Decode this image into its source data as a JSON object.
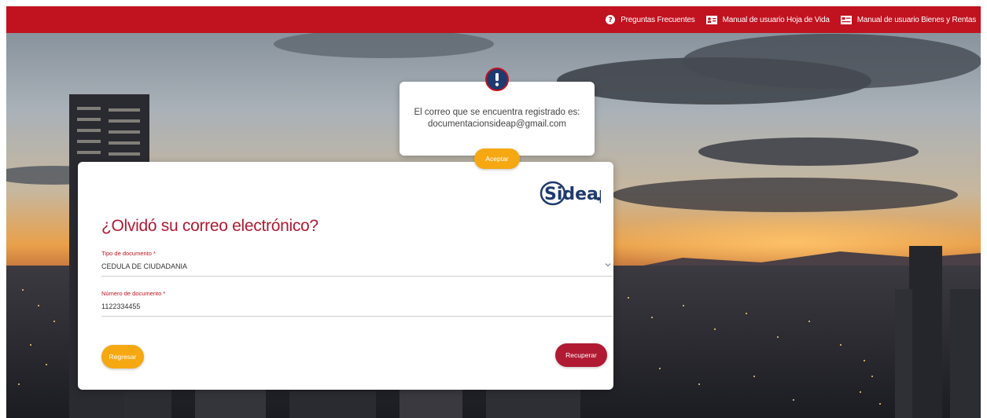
{
  "topbar": {
    "links": [
      {
        "label": "Preguntas Frecuentes",
        "icon": "question-circle-icon"
      },
      {
        "label": "Manual de usuario Hoja de Vida",
        "icon": "id-card-icon"
      },
      {
        "label": "Manual de usuario Bienes y Rentas",
        "icon": "document-card-icon"
      }
    ]
  },
  "alert": {
    "icon": "exclamation-icon",
    "line1": "El correo que se encuentra registrado es:",
    "line2": "documentacionsideap@gmail.com",
    "accept_label": "Aceptar"
  },
  "card": {
    "logo_text": "Sideap",
    "title": "¿Olvidó su correo electrónico?",
    "document_type": {
      "label": "Tipo de documento *",
      "value": "CEDULA DE CIUDADANIA"
    },
    "document_number": {
      "label": "Número de documento *",
      "value": "1122334455"
    },
    "back_label": "Regresar",
    "recover_label": "Recuperar"
  },
  "colors": {
    "brand_red": "#c1121f",
    "title_red": "#b01a33",
    "accent_yellow": "#f5a812"
  }
}
